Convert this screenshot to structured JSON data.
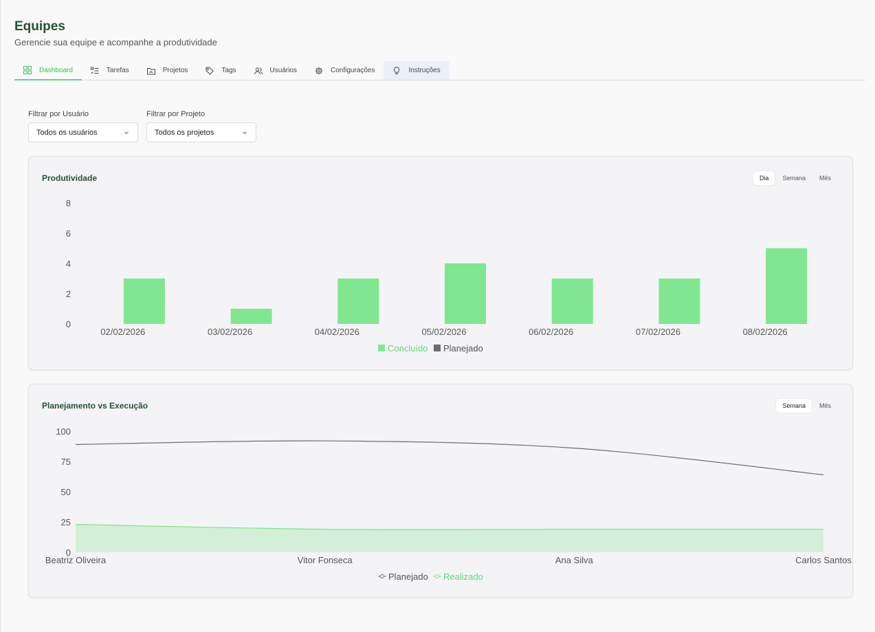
{
  "header": {
    "title": "Equipes",
    "subtitle": "Gerencie sua equipe e acompanhe a produtividade"
  },
  "tabs": [
    {
      "label": "Dashboard",
      "icon": "dashboard-icon"
    },
    {
      "label": "Tarefas",
      "icon": "task-list-icon"
    },
    {
      "label": "Projetos",
      "icon": "folder-icon"
    },
    {
      "label": "Tags",
      "icon": "tag-icon"
    },
    {
      "label": "Usuários",
      "icon": "users-icon"
    },
    {
      "label": "Configurações",
      "icon": "gear-icon"
    },
    {
      "label": "Instruções",
      "icon": "lightbulb-icon"
    }
  ],
  "filters": {
    "user_label": "Filtrar por Usuário",
    "user_value": "Todos os usuários",
    "project_label": "Filtrar por Projeto",
    "project_value": "Todos os projetos"
  },
  "productivity": {
    "title": "Produtividade",
    "periods": [
      "Dia",
      "Semana",
      "Mês"
    ],
    "active_period": "Dia"
  },
  "planning": {
    "title": "Planejamento vs Execução",
    "periods": [
      "Semana",
      "Mês"
    ],
    "active_period": "Semana"
  },
  "colors": {
    "accent": "#5fd978",
    "bar_concluido": "#80e690",
    "bar_planejado": "#6b6b72",
    "line_planejado": "#6b6b72",
    "line_realizado": "#7ee28d",
    "title_green": "#245233"
  },
  "chart_data": [
    {
      "type": "bar",
      "categories": [
        "02/02/2026",
        "03/02/2026",
        "04/02/2026",
        "05/02/2026",
        "06/02/2026",
        "07/02/2026",
        "08/02/2026"
      ],
      "series": [
        {
          "name": "Concluído",
          "values": [
            3,
            1,
            3,
            4,
            3,
            3,
            5
          ]
        },
        {
          "name": "Planejado",
          "values": [
            0,
            0,
            0,
            0,
            0,
            0,
            0
          ]
        }
      ],
      "ylim": [
        0,
        8
      ],
      "yticks": [
        0,
        2,
        4,
        6,
        8
      ],
      "legend": "bottom",
      "grid": false
    },
    {
      "type": "line",
      "categories": [
        "Beatriz Oliveira",
        "Vitor Fonseca",
        "Ana Silva",
        "Carlos Santos"
      ],
      "series": [
        {
          "name": "Planejado",
          "values": [
            89,
            92,
            86,
            64
          ]
        },
        {
          "name": "Realizado",
          "values": [
            23,
            19,
            19,
            19
          ],
          "fill": true
        }
      ],
      "ylim": [
        0,
        100
      ],
      "yticks": [
        0,
        25,
        50,
        75,
        100
      ],
      "legend": "bottom",
      "grid": false
    }
  ]
}
